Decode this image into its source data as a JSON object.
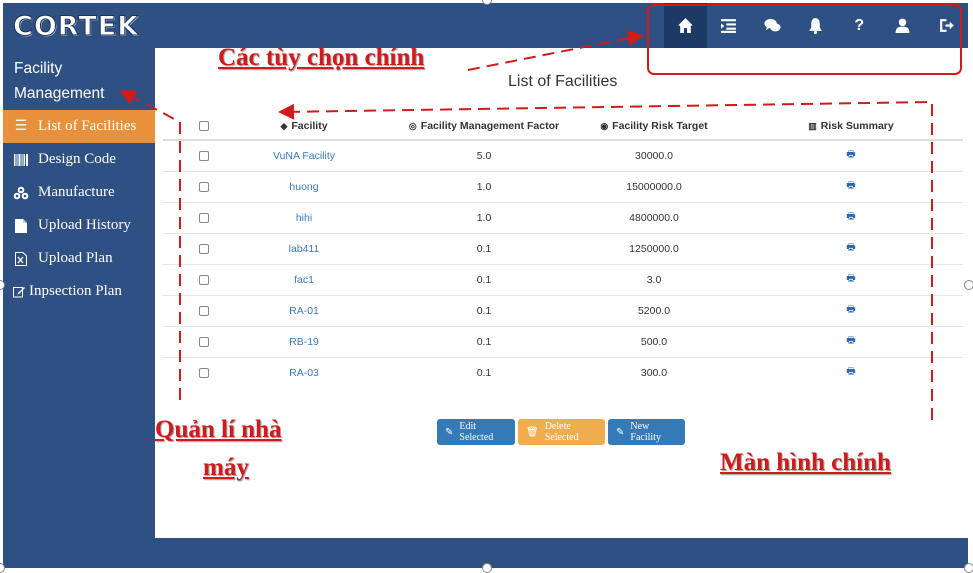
{
  "brand": {
    "logo": "CORTEK"
  },
  "nav": {
    "icons": [
      "home-icon",
      "list-icon",
      "chat-icon",
      "bell-icon",
      "help-icon",
      "user-icon",
      "logout-icon"
    ],
    "help_glyph": "?"
  },
  "sidebar": {
    "title": "Facility Management",
    "items": [
      {
        "label": "List of Facilities",
        "icon": "list-icon",
        "active": true
      },
      {
        "label": "Design Code",
        "icon": "barcode-icon"
      },
      {
        "label": "Manufacture",
        "icon": "cubes-icon"
      },
      {
        "label": "Upload History",
        "icon": "file-icon"
      },
      {
        "label": "Upload Plan",
        "icon": "excel-file-icon"
      },
      {
        "label": "Inpsection Plan",
        "icon": "edit-icon"
      }
    ]
  },
  "main": {
    "title": "List of Facilities",
    "columns": [
      "Facility",
      "Facility Management Factor",
      "Facility Risk Target",
      "Risk Summary"
    ],
    "rows": [
      {
        "facility": "VuNA Facility",
        "factor": "5.0",
        "target": "30000.0"
      },
      {
        "facility": "huong",
        "factor": "1.0",
        "target": "15000000.0"
      },
      {
        "facility": "hihi",
        "factor": "1.0",
        "target": "4800000.0"
      },
      {
        "facility": "lab411",
        "factor": "0.1",
        "target": "1250000.0"
      },
      {
        "facility": "fac1",
        "factor": "0.1",
        "target": "3.0"
      },
      {
        "facility": "RA-01",
        "factor": "0.1",
        "target": "5200.0"
      },
      {
        "facility": "RB-19",
        "factor": "0.1",
        "target": "500.0"
      },
      {
        "facility": "RA-03",
        "factor": "0.1",
        "target": "300.0"
      }
    ],
    "buttons": {
      "edit": "Edit Selected",
      "delete": "Delete Selected",
      "new": "New Facility"
    }
  },
  "annotations": {
    "options": "Các tùy chọn chính",
    "facility_mgmt_line1": "Quản lí nhà",
    "facility_mgmt_line2": "máy",
    "main_screen": "Màn hình chính"
  },
  "colors": {
    "navbar": "#2f5082",
    "active_item": "#e8913a",
    "annotation": "#d11a1a"
  }
}
